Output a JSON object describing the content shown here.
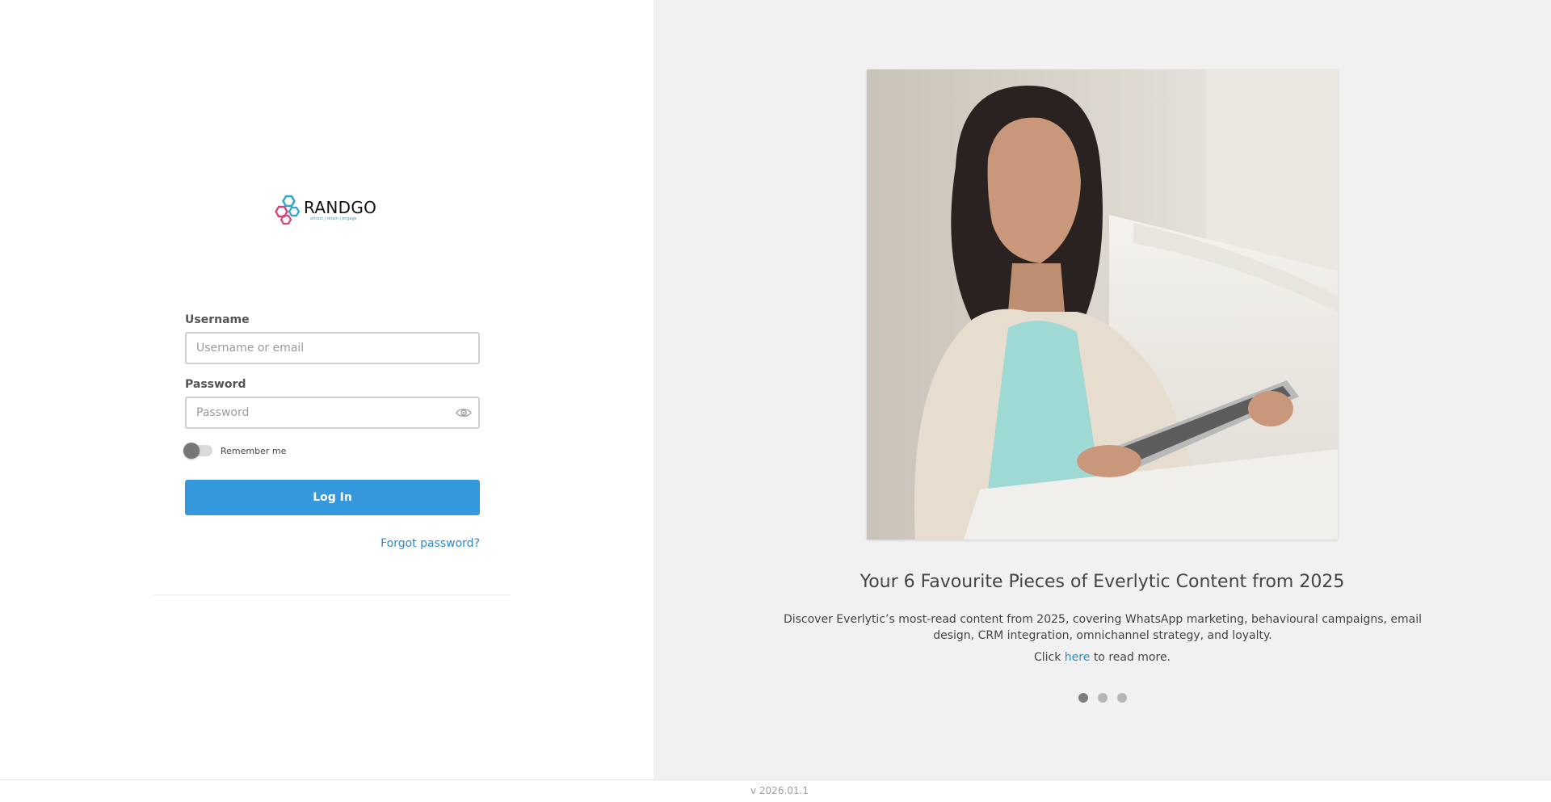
{
  "login": {
    "logo_alt": "RANDGO attract | retain | engage",
    "username_label": "Username",
    "username_placeholder": "Username or email",
    "username_value": "",
    "password_label": "Password",
    "password_placeholder": "Password",
    "password_value": "",
    "remember_label": "Remember me",
    "remember_checked": false,
    "login_button": "Log In",
    "forgot_link": "Forgot password?"
  },
  "slide": {
    "title": "Your 6 Favourite Pieces of Everlytic Content from 2025",
    "description": "Discover Everlytic’s most-read content from 2025, covering WhatsApp marketing, behavioural campaigns, email design, CRM integration, omnichannel strategy, and loyalty.",
    "cta_prefix": "Click",
    "cta_link": "here",
    "cta_suffix": "to read more.",
    "dots": [
      {
        "active": true
      },
      {
        "active": false
      },
      {
        "active": false
      }
    ]
  },
  "footer": {
    "version": "v 2026.01.1"
  },
  "colors": {
    "primary_button": "#3597dc",
    "link": "#2a8bc9",
    "right_panel_bg": "#f1f1f1",
    "logo_teal": "#2aa7c9",
    "logo_pink": "#d6457c"
  }
}
